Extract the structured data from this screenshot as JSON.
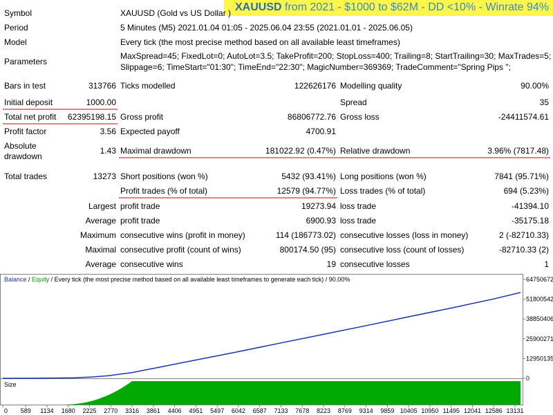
{
  "banner": {
    "symbol": "XAUUSD",
    "text": "from 2021 - $1000 to $62M - DD <10% - Winrate 94%"
  },
  "info": {
    "symbol_label": "Symbol",
    "symbol_value": "XAUUSD (Gold vs US Dollar )",
    "period_label": "Period",
    "period_value": "5 Minutes (M5) 2021.01.04 01:05 - 2025.06.04 23:55 (2021.01.01 - 2025.06.05)",
    "model_label": "Model",
    "model_value": "Every tick (the most precise method based on all available least timeframes)",
    "params_label": "Parameters",
    "params_line1": "MaxSpread=45; FixedLot=0; AutoLot=3.5; TakeProfit=200; StopLoss=400; Trailing=8; StartTrailing=30; MaxTrades=5;",
    "params_line2": "Slippage=6; TimeStart=\"01:30\"; TimeEnd=\"22:30\"; MagicNumber=369369; TradeComment=\"Spring Pips \";"
  },
  "stats": {
    "bars_label": "Bars in test",
    "bars_value": "313766",
    "ticks_label": "Ticks modelled",
    "ticks_value": "122626176",
    "quality_label": "Modelling quality",
    "quality_value": "90.00%",
    "deposit_label": "Initial deposit",
    "deposit_value": "1000.00",
    "spread_label": "Spread",
    "spread_value": "35",
    "net_label": "Total net profit",
    "net_value": "62395198.15",
    "gross_profit_label": "Gross profit",
    "gross_profit_value": "86806772.76",
    "gross_loss_label": "Gross loss",
    "gross_loss_value": "-24411574.61",
    "pf_label": "Profit factor",
    "pf_value": "3.56",
    "payoff_label": "Expected payoff",
    "payoff_value": "4700.91",
    "abs_dd_label1": "Absolute",
    "abs_dd_label2": "drawdown",
    "abs_dd_value": "1.43",
    "max_dd_label": "Maximal drawdown",
    "max_dd_value": "181022.92 (0.47%)",
    "rel_dd_label": "Relative drawdown",
    "rel_dd_value": "3.96% (7817.48)",
    "trades_label": "Total trades",
    "trades_value": "13273",
    "short_label": "Short positions (won %)",
    "short_value": "5432 (93.41%)",
    "long_label": "Long positions (won %)",
    "long_value": "7841 (95.71%)",
    "profit_trades_label": "Profit trades (% of total)",
    "profit_trades_value": "12579 (94.77%)",
    "loss_trades_label": "Loss trades (% of total)",
    "loss_trades_value": "694 (5.23%)",
    "largest_label": "Largest",
    "largest_pt_label": "profit trade",
    "largest_pt_value": "19273.94",
    "largest_lt_label": "loss trade",
    "largest_lt_value": "-41394.10",
    "average_label": "Average",
    "average_pt_label": "profit trade",
    "average_pt_value": "6900.93",
    "average_lt_label": "loss trade",
    "average_lt_value": "-35175.18",
    "maximum_label": "Maximum",
    "max_wins_label": "consecutive wins (profit in money)",
    "max_wins_value": "114 (186773.02)",
    "max_losses_label": "consecutive losses (loss in money)",
    "max_losses_value": "2 (-82710.33)",
    "maximal_label": "Maximal",
    "maximal_profit_label": "consecutive profit (count of wins)",
    "maximal_profit_value": "800174.50 (95)",
    "maximal_loss_label": "consecutive loss (count of losses)",
    "maximal_loss_value": "-82710.33 (2)",
    "avg2_label": "Average",
    "avg_wins_label": "consecutive wins",
    "avg_wins_value": "19",
    "avg_losses_label": "consecutive losses",
    "avg_losses_value": "1"
  },
  "chart_data": {
    "type": "line",
    "legend_balance": "Balance",
    "legend_sep": "/",
    "legend_equity": "Equity",
    "legend_rest": "/ Every tick (the most precise method based on all available least timeframes to generate each tick) / 90.00%",
    "y_ticks": [
      "64750672",
      "51800542",
      "38850406",
      "25900271",
      "12950135",
      "0"
    ],
    "y_tick_values": [
      64750672,
      51800542,
      38850406,
      25900271,
      12950135,
      0
    ],
    "x_ticks": [
      "0",
      "589",
      "1134",
      "1680",
      "2225",
      "2770",
      "3316",
      "3861",
      "4406",
      "4951",
      "5497",
      "6042",
      "6587",
      "7133",
      "7678",
      "8223",
      "8769",
      "9314",
      "9859",
      "10405",
      "10950",
      "11495",
      "12041",
      "12586",
      "13131"
    ],
    "x_tick_values": [
      0,
      589,
      1134,
      1680,
      2225,
      2770,
      3316,
      3861,
      4406,
      4951,
      5497,
      6042,
      6587,
      7133,
      7678,
      8223,
      8769,
      9314,
      9859,
      10405,
      10950,
      11495,
      12041,
      12586,
      13131
    ],
    "xlim": [
      0,
      13273
    ],
    "ylim": [
      0,
      64750672
    ],
    "balance_x": [
      0,
      1000,
      1800,
      2300,
      2700,
      3000,
      3316,
      3861,
      4951,
      6042,
      7133,
      8223,
      9314,
      10405,
      11495,
      12586,
      13273
    ],
    "balance_y": [
      1000,
      80000,
      300000,
      900000,
      1700000,
      2700000,
      3800000,
      6500000,
      12000000,
      17500000,
      23200000,
      28800000,
      34500000,
      40300000,
      46000000,
      52000000,
      56200000
    ],
    "size_panel_label": "Size",
    "size_color": "#00aa00",
    "balance_color": "#1a33a8",
    "equity_color": "#00a000"
  }
}
